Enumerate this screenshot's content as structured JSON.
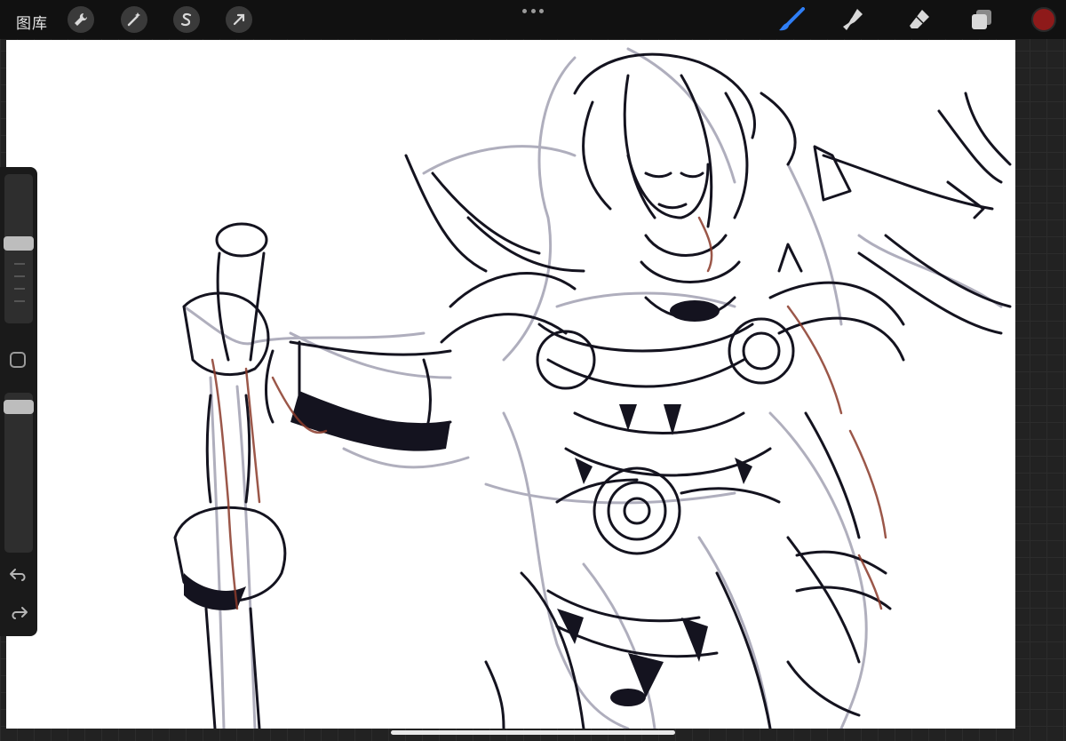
{
  "topbar": {
    "gallery_label": "图库",
    "left_tools": [
      "wrench-icon",
      "magic-wand-icon",
      "selection-s-icon",
      "arrow-cursor-icon"
    ],
    "right_tools": [
      "brush-icon",
      "smudge-icon",
      "eraser-icon",
      "layers-icon"
    ],
    "active_tool": "brush-icon",
    "current_color": "#8e1a1a",
    "accent_color": "#2f7ef5"
  },
  "sidebar": {
    "brush_size_level": 0.58,
    "opacity_level": 0.96
  },
  "canvas": {
    "background": "#ffffff",
    "ink_color": "#14131f",
    "sketch_color": "#a7a6b6",
    "blood_color": "#8a3a2a"
  }
}
